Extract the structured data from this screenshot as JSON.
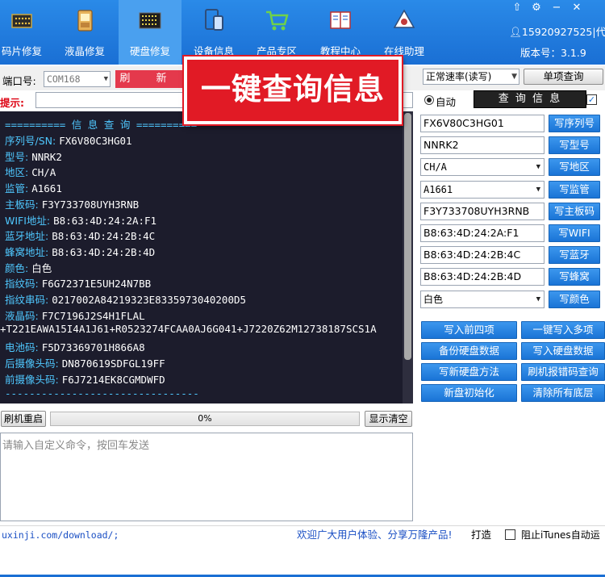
{
  "toolbar": {
    "tabs": [
      {
        "label": "码片修复",
        "icon": "chip-icon"
      },
      {
        "label": "液晶修复",
        "icon": "phone-repair-icon"
      },
      {
        "label": "硬盘修复",
        "icon": "board-icon"
      },
      {
        "label": "设备信息",
        "icon": "device-icon"
      },
      {
        "label": "产品专区",
        "icon": "cart-icon"
      },
      {
        "label": "教程中心",
        "icon": "book-icon"
      },
      {
        "label": "在线助理",
        "icon": "assistant-icon"
      }
    ],
    "active_tab": "硬盘修复",
    "window_controls": {
      "pin": "⇧",
      "settings": "⚙",
      "minimize": "−",
      "close": "✕"
    },
    "phone": "15920927525|代理",
    "version": "版本号：3.1.9"
  },
  "port": {
    "label": "端口号:",
    "value": "COM168",
    "refresh_label": "刷  新",
    "hint_label": "提示:"
  },
  "banner": "一键查询信息",
  "speed": {
    "mode_value": "正常速率(读写)",
    "single_query_label": "单项查询",
    "auto_label": "自动",
    "query_label": "查 询 信 息"
  },
  "console": {
    "header": "========== 信 息 查 询 ==========",
    "lines": [
      {
        "key": "序列号/SN:",
        "value": "FX6V80C3HG01"
      },
      {
        "key": "型号:",
        "value": "NNRK2"
      },
      {
        "key": "地区:",
        "value": "CH/A"
      },
      {
        "key": "监管:",
        "value": "A1661"
      },
      {
        "key": "主板码:",
        "value": "F3Y733708UYH3RNB"
      },
      {
        "key": "WIFI地址:",
        "value": "B8:63:4D:24:2A:F1"
      },
      {
        "key": "蓝牙地址:",
        "value": "B8:63:4D:24:2B:4C"
      },
      {
        "key": "蜂窝地址:",
        "value": "B8:63:4D:24:2B:4D"
      },
      {
        "key": "颜色:",
        "value": "白色"
      },
      {
        "key": "指纹码:",
        "value": "F6G72371E5UH24N7BB"
      },
      {
        "key": "指纹串码:",
        "value": "0217002A84219323E8335973040200D5"
      },
      {
        "key": "液晶码:",
        "value": "F7C7196J2S4H1FLAL"
      },
      {
        "key": "",
        "value": "+T221EAWA15I4A1J61+R0523274FCAA0AJ6G041+J7220Z62M12738187SCS1A"
      },
      {
        "key": "电池码:",
        "value": "F5D73369701H866A8"
      },
      {
        "key": "后摄像头码:",
        "value": "DN870619SDFGL19FF"
      },
      {
        "key": "前摄像头码:",
        "value": "F6J7214EK8CGMDWFD"
      }
    ],
    "footer": "--------------------------------"
  },
  "progress": {
    "reboot_label": "刷机重启",
    "value_text": "0%",
    "value": 0,
    "clear_label": "显示清空"
  },
  "command": {
    "placeholder": "请输入自定义命令，按回车发送"
  },
  "status": {
    "link": "uxinji.com/download/;",
    "welcome": "欢迎广大用户体验、分享万隆产品!",
    "make_label": "打造",
    "itunes_label": "阻止iTunes自动运"
  },
  "fields": [
    {
      "value": "FX6V80C3HG01",
      "button": "写序列号",
      "dropdown": false
    },
    {
      "value": "NNRK2",
      "button": "写型号",
      "dropdown": false
    },
    {
      "value": "CH/A",
      "button": "写地区",
      "dropdown": true
    },
    {
      "value": "A1661",
      "button": "写监管",
      "dropdown": true
    },
    {
      "value": "F3Y733708UYH3RNB",
      "button": "写主板码",
      "dropdown": false
    },
    {
      "value": "B8:63:4D:24:2A:F1",
      "button": "写WIFI",
      "dropdown": false
    },
    {
      "value": "B8:63:4D:24:2B:4C",
      "button": "写蓝牙",
      "dropdown": false
    },
    {
      "value": "B8:63:4D:24:2B:4D",
      "button": "写蜂窝",
      "dropdown": false
    },
    {
      "value": "白色",
      "button": "写颜色",
      "dropdown": true
    }
  ],
  "actions": [
    "写入前四项",
    "一键写入多项",
    "备份硬盘数据",
    "写入硬盘数据",
    "写新硬盘方法",
    "刷机报错码查询",
    "新盘初始化",
    "清除所有底层"
  ]
}
